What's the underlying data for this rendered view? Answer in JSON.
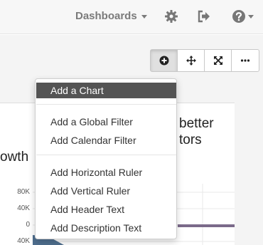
{
  "navbar": {
    "dashboards_label": "Dashboards",
    "icons": [
      "gear-icon",
      "sign-out-icon",
      "help-icon"
    ]
  },
  "toolbar": {
    "buttons": [
      "plus-circle-icon",
      "move-icon",
      "expand-icon",
      "ellipsis-icon"
    ]
  },
  "background_card": {
    "title_left": "owth",
    "title_right_line1": "better",
    "title_right_line2": "tors",
    "y_ticks": [
      "80K",
      "40K",
      "0",
      "40K"
    ]
  },
  "add_menu": {
    "items": [
      "Add a Chart",
      "Add a Global Filter",
      "Add Calendar Filter",
      "Add Horizontal Ruler",
      "Add Vertical Ruler",
      "Add Header Text",
      "Add Description Text"
    ],
    "highlighted": "Add a Chart"
  },
  "colors": {
    "menu_highlight": "#545454",
    "chart_fill": "#4f6f8f",
    "series_line": "#7b6a8a"
  }
}
